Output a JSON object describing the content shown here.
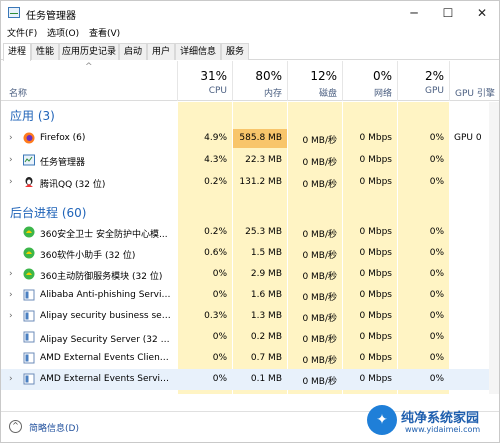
{
  "window": {
    "title": "任务管理器",
    "controls": [
      "─",
      "☐",
      "✕"
    ]
  },
  "menu": [
    "文件(F)",
    "选项(O)",
    "查看(V)"
  ],
  "tabs": [
    "进程",
    "性能",
    "应用历史记录",
    "启动",
    "用户",
    "详细信息",
    "服务"
  ],
  "header": {
    "name": "名称",
    "cols": [
      {
        "pct": "31%",
        "label": "CPU"
      },
      {
        "pct": "80%",
        "label": "内存"
      },
      {
        "pct": "12%",
        "label": "磁盘"
      },
      {
        "pct": "0%",
        "label": "网络"
      },
      {
        "pct": "2%",
        "label": "GPU"
      },
      {
        "pct": "",
        "label": "GPU 引擎"
      }
    ]
  },
  "groups": {
    "apps": "应用 (3)",
    "background": "后台进程 (60)"
  },
  "apps": [
    {
      "name": "Firefox (6)",
      "icon": "firefox-icon",
      "cpu": "4.9%",
      "mem": "585.8 MB",
      "disk": "0 MB/秒",
      "net": "0 Mbps",
      "gpu": "0%",
      "engine": "GPU 0"
    },
    {
      "name": "任务管理器",
      "icon": "task-manager-icon",
      "cpu": "4.3%",
      "mem": "22.3 MB",
      "disk": "0 MB/秒",
      "net": "0 Mbps",
      "gpu": "0%",
      "engine": ""
    },
    {
      "name": "腾讯QQ (32 位)",
      "icon": "qq-icon",
      "cpu": "0.2%",
      "mem": "131.2 MB",
      "disk": "0 MB/秒",
      "net": "0 Mbps",
      "gpu": "0%",
      "engine": ""
    }
  ],
  "background": [
    {
      "name": "360安全卫士 安全防护中心模...",
      "icon": "360-icon",
      "cpu": "0.2%",
      "mem": "25.3 MB",
      "disk": "0 MB/秒",
      "net": "0 Mbps",
      "gpu": "0%",
      "engine": ""
    },
    {
      "name": "360软件小助手 (32 位)",
      "icon": "360-icon",
      "cpu": "0.6%",
      "mem": "1.5 MB",
      "disk": "0 MB/秒",
      "net": "0 Mbps",
      "gpu": "0%",
      "engine": ""
    },
    {
      "name": "360主动防御服务模块 (32 位)",
      "icon": "360-icon",
      "cpu": "0%",
      "mem": "2.9 MB",
      "disk": "0 MB/秒",
      "net": "0 Mbps",
      "gpu": "0%",
      "engine": ""
    },
    {
      "name": "Alibaba Anti-phishing Servic...",
      "icon": "service-icon",
      "cpu": "0%",
      "mem": "1.6 MB",
      "disk": "0 MB/秒",
      "net": "0 Mbps",
      "gpu": "0%",
      "engine": ""
    },
    {
      "name": "Alipay security business servi...",
      "icon": "service-icon",
      "cpu": "0.3%",
      "mem": "1.3 MB",
      "disk": "0 MB/秒",
      "net": "0 Mbps",
      "gpu": "0%",
      "engine": ""
    },
    {
      "name": "Alipay Security Server (32 位)",
      "icon": "service-icon",
      "cpu": "0%",
      "mem": "0.2 MB",
      "disk": "0 MB/秒",
      "net": "0 Mbps",
      "gpu": "0%",
      "engine": ""
    },
    {
      "name": "AMD External Events Client ...",
      "icon": "service-icon",
      "cpu": "0%",
      "mem": "0.7 MB",
      "disk": "0 MB/秒",
      "net": "0 Mbps",
      "gpu": "0%",
      "engine": ""
    },
    {
      "name": "AMD External Events Service...",
      "icon": "service-icon",
      "cpu": "0%",
      "mem": "0.1 MB",
      "disk": "0 MB/秒",
      "net": "0 Mbps",
      "gpu": "0%",
      "engine": ""
    }
  ],
  "footer": {
    "label": "简略信息(D)"
  },
  "watermark": {
    "title": "纯净系统家园",
    "url": "www.yidaimei.com"
  },
  "colors": {
    "heat_light": "#fff4c4",
    "heat_hot": "#f8c56b",
    "group_text": "#1f63b8",
    "selected_row": "#e8f1fb"
  }
}
